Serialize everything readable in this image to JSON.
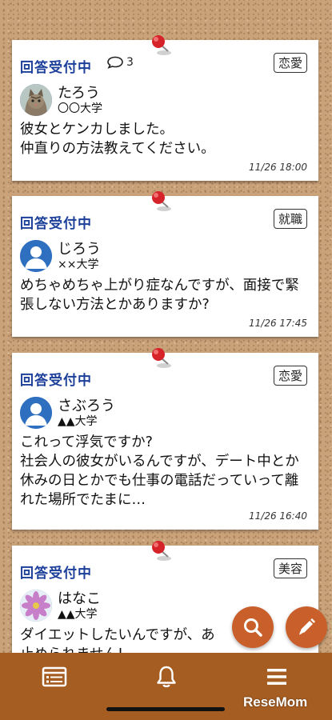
{
  "posts": [
    {
      "status": "回答受付中",
      "comment_count": "3",
      "category": "恋愛",
      "username": "たろう",
      "university": "〇〇大学",
      "body": "彼女とケンカしました。\n仲直りの方法教えてください。",
      "time": "11/26 18:00",
      "avatar": "cat-photo"
    },
    {
      "status": "回答受付中",
      "category": "就職",
      "username": "じろう",
      "university": "××大学",
      "body": "めちゃめちゃ上がり症なんですが、面接で緊張しない方法とかありますか?",
      "time": "11/26 17:45",
      "avatar": "default-user"
    },
    {
      "status": "回答受付中",
      "category": "恋愛",
      "username": "さぶろう",
      "university": "▲▲大学",
      "body": "これって浮気ですか?\n社会人の彼女がいるんですが、デート中とか休みの日とかでも仕事の電話だっていって離れた場所でたまに…",
      "time": "11/26 16:40",
      "avatar": "default-user"
    },
    {
      "status": "回答受付中",
      "category": "美容",
      "username": "はなこ",
      "university": "▲▲大学",
      "body": "ダイエットしたいんですが、あ\n止められません!",
      "avatar": "flower-photo"
    }
  ],
  "fab": {
    "search_icon": "search-icon",
    "edit_icon": "pencil-icon"
  },
  "nav": [
    {
      "icon": "list-icon"
    },
    {
      "icon": "bell-icon"
    },
    {
      "icon": "menu-icon"
    }
  ],
  "watermark": "ReseMom",
  "colors": {
    "accent": "#c9602b",
    "status": "#1c3f9a",
    "bar": "#a65d22",
    "pin": "#d6232a"
  }
}
